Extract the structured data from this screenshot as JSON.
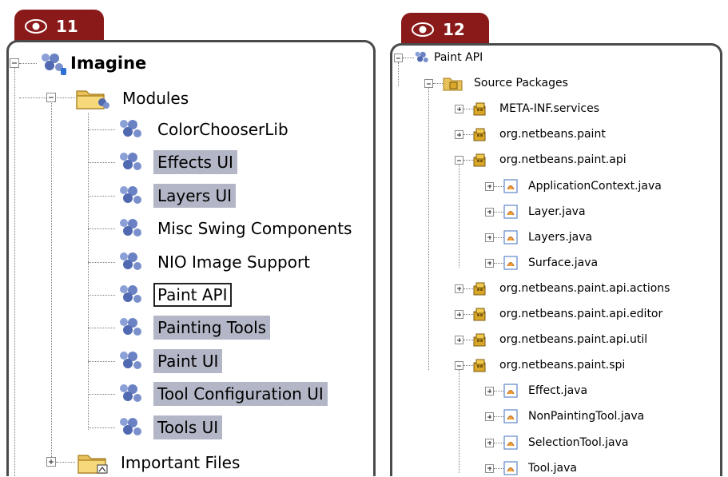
{
  "left_panel": {
    "badge": "11",
    "root": "Imagine",
    "modules_folder": "Modules",
    "modules": [
      {
        "label": "ColorChooserLib",
        "state": "normal"
      },
      {
        "label": "Effects UI",
        "state": "selected"
      },
      {
        "label": "Layers UI",
        "state": "selected"
      },
      {
        "label": "Misc Swing Components",
        "state": "normal"
      },
      {
        "label": "NIO Image Support",
        "state": "normal"
      },
      {
        "label": "Paint API",
        "state": "focused"
      },
      {
        "label": "Painting Tools",
        "state": "selected"
      },
      {
        "label": "Paint UI",
        "state": "selected"
      },
      {
        "label": "Tool Configuration UI",
        "state": "selected"
      },
      {
        "label": "Tools UI",
        "state": "selected"
      }
    ],
    "important_files": "Important Files"
  },
  "right_panel": {
    "badge": "12",
    "root": "Paint API",
    "source_packages": "Source Packages",
    "packages": {
      "meta_inf": "META-INF.services",
      "paint": "org.netbeans.paint",
      "api": "org.netbeans.paint.api",
      "actions": "org.netbeans.paint.api.actions",
      "editor": "org.netbeans.paint.api.editor",
      "util": "org.netbeans.paint.api.util",
      "spi": "org.netbeans.paint.spi"
    },
    "api_files": [
      "ApplicationContext.java",
      "Layer.java",
      "Layers.java",
      "Surface.java"
    ],
    "spi_files": [
      "Effect.java",
      "NonPaintingTool.java",
      "SelectionTool.java",
      "Tool.java"
    ]
  },
  "colors": {
    "badge": "#8a1a1a",
    "selection": "#b3b6c6",
    "frame": "#4a4a4a"
  },
  "icons": [
    "eye-icon",
    "module-icon",
    "folder-icon",
    "package-icon",
    "java-file-icon",
    "expander-icon"
  ]
}
